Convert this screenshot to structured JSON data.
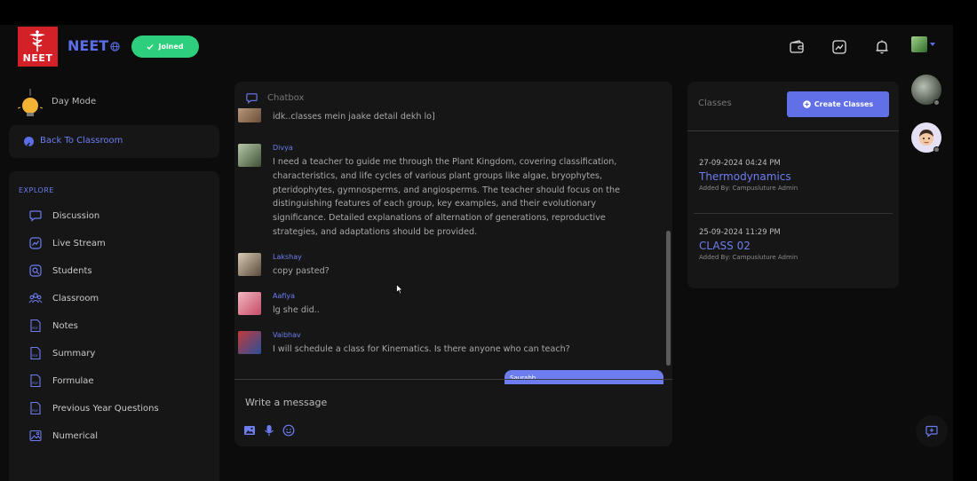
{
  "header": {
    "logo_text": "NEET",
    "brand": "NEET",
    "joined_label": "Joined"
  },
  "sidebar": {
    "day_mode_label": "Day Mode",
    "back_label": "Back To Classroom",
    "explore_title": "EXPLORE",
    "items": [
      {
        "label": "Discussion",
        "icon": "chat-bubble-icon"
      },
      {
        "label": "Live Stream",
        "icon": "trend-icon"
      },
      {
        "label": "Students",
        "icon": "student-search-icon"
      },
      {
        "label": "Classroom",
        "icon": "group-icon"
      },
      {
        "label": "Notes",
        "icon": "pdf-file-icon"
      },
      {
        "label": "Summary",
        "icon": "pdf-file-icon"
      },
      {
        "label": "Formulae",
        "icon": "pdf-file-icon"
      },
      {
        "label": "Previous Year Questions",
        "icon": "pdf-file-icon"
      },
      {
        "label": "Numerical",
        "icon": "image-icon"
      }
    ]
  },
  "chat": {
    "title": "Chatbox",
    "messages": [
      {
        "name": "",
        "text": "idk..classes mein jaake detail dekh lo]"
      },
      {
        "name": "Divya",
        "text": "I need a teacher to guide me through the Plant Kingdom, covering classification, characteristics, and life cycles of various plant groups like algae, bryophytes, pteridophytes, gymnosperms, and angiosperms. The teacher should focus on the distinguishing features of each group, key examples, and their evolutionary significance. Detailed explanations of alternation of generations, reproductive strategies, and adaptations should be provided."
      },
      {
        "name": "Lakshay",
        "text": "copy pasted?"
      },
      {
        "name": "Aafiya",
        "text": "lg she did.."
      },
      {
        "name": "Vaibhav",
        "text": "I will schedule a class for Kinematics. Is there anyone who can teach?"
      }
    ],
    "own_bubble_name": "Saurabh",
    "input_placeholder": "Write a message"
  },
  "classes": {
    "title": "Classes",
    "create_label": "Create Classes",
    "items": [
      {
        "datetime": "27-09-2024 04:24 PM",
        "name": "Thermodynamics",
        "added_by": "Added By: Campusluture Admin"
      },
      {
        "datetime": "25-09-2024 11:29 PM",
        "name": "CLASS 02",
        "added_by": "Added By: Campusluture Admin"
      }
    ]
  },
  "colors": {
    "accent": "#6d7df0",
    "success": "#2ecf7c",
    "brand_red": "#d42027",
    "panel": "#161616",
    "background": "#0c0c0c"
  }
}
